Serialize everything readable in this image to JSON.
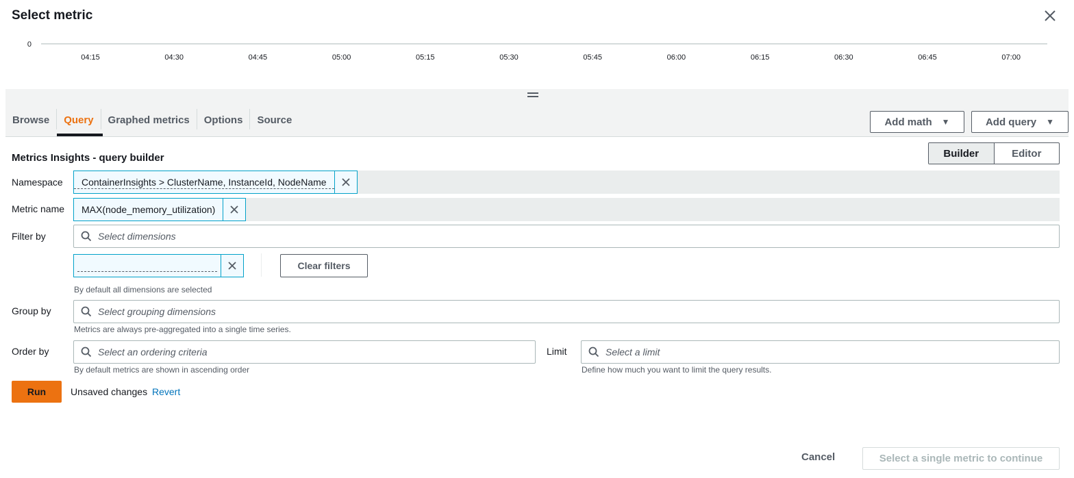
{
  "dialog": {
    "title": "Select metric"
  },
  "chart": {
    "y_tick": "0",
    "x_ticks": [
      "04:15",
      "04:30",
      "04:45",
      "05:00",
      "05:15",
      "05:30",
      "05:45",
      "06:00",
      "06:15",
      "06:30",
      "06:45",
      "07:00"
    ]
  },
  "tabs": [
    {
      "label": "Browse"
    },
    {
      "label": "Query"
    },
    {
      "label": "Graphed metrics"
    },
    {
      "label": "Options"
    },
    {
      "label": "Source"
    }
  ],
  "actions": {
    "add_math": "Add math",
    "add_query": "Add query"
  },
  "builder": {
    "title": "Metrics Insights - query builder",
    "mode_builder": "Builder",
    "mode_editor": "Editor",
    "namespace_label": "Namespace",
    "namespace_value": "ContainerInsights > ClusterName, InstanceId, NodeName",
    "metric_label": "Metric name",
    "metric_value": "MAX(node_memory_utilization)",
    "filter_label": "Filter by",
    "filter_placeholder": "Select dimensions",
    "filter_token_value": "",
    "clear_filters": "Clear filters",
    "filter_hint": "By default all dimensions are selected",
    "group_label": "Group by",
    "group_placeholder": "Select grouping dimensions",
    "group_hint": "Metrics are always pre-aggregated into a single time series.",
    "order_label": "Order by",
    "order_placeholder": "Select an ordering criteria",
    "order_hint": "By default metrics are shown in ascending order",
    "limit_label": "Limit",
    "limit_placeholder": "Select a limit",
    "limit_hint": "Define how much you want to limit the query results.",
    "run": "Run",
    "unsaved": "Unsaved changes",
    "revert": "Revert"
  },
  "footer": {
    "cancel": "Cancel",
    "continue": "Select a single metric to continue"
  },
  "colors": {
    "accent": "#ec7211",
    "link": "#0073bb",
    "token_border": "#00a1c9"
  }
}
